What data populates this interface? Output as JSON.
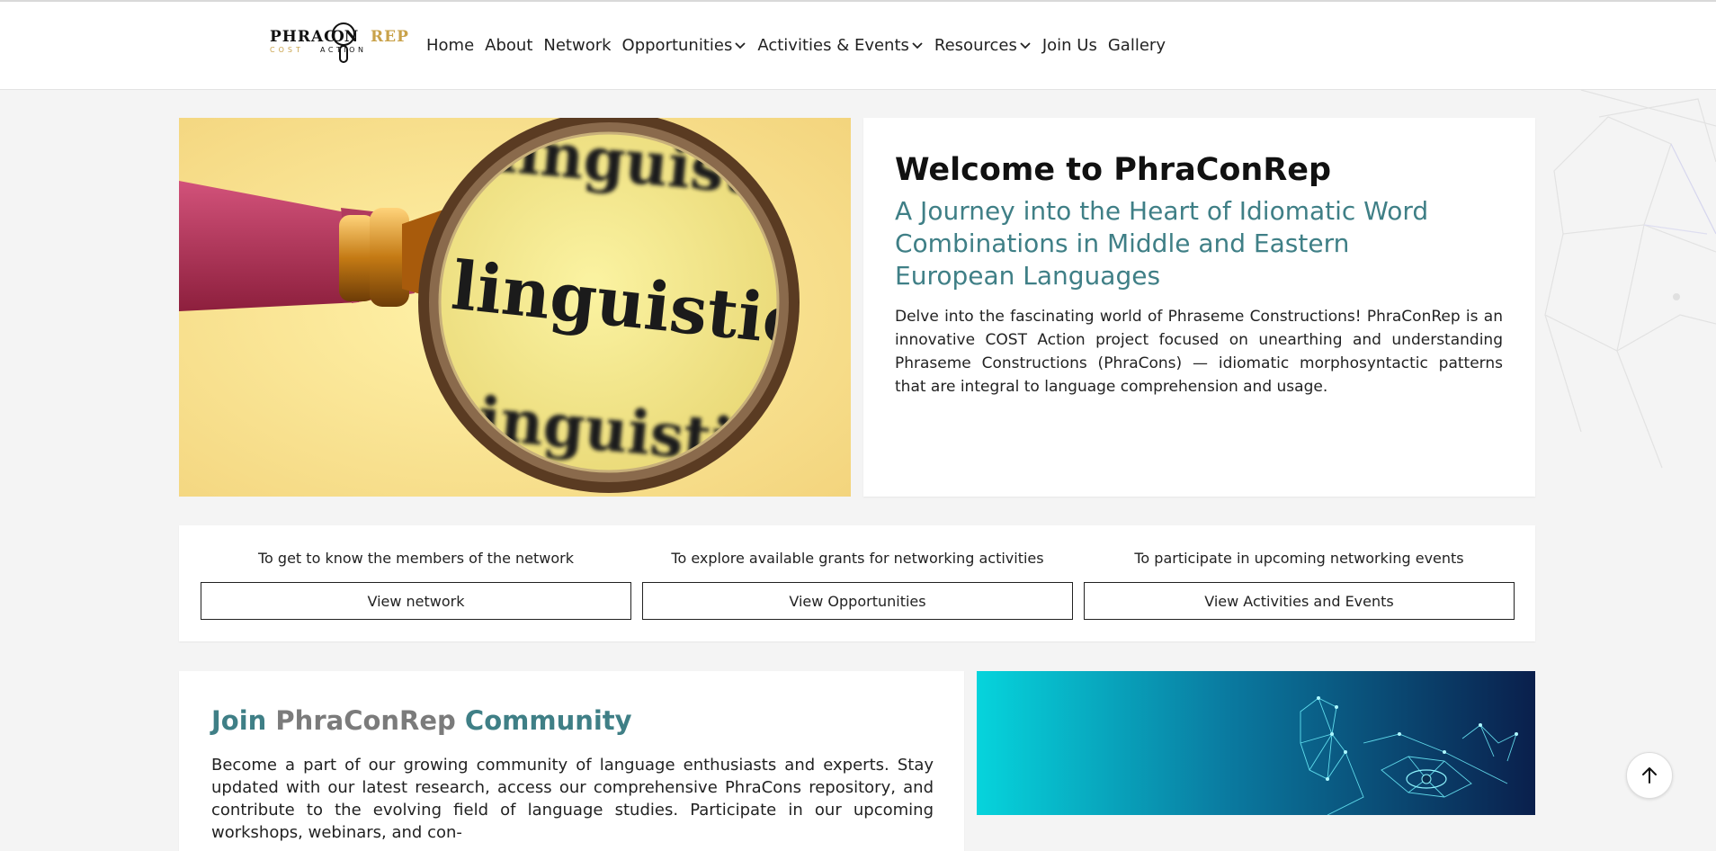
{
  "logo": {
    "line1_left": "PHRAC",
    "line1_mid": "ON",
    "line1_right": "REP",
    "line2_left": "COST",
    "line2_right": "ACTION"
  },
  "nav": {
    "items": [
      {
        "label": "Home",
        "dropdown": false
      },
      {
        "label": "About",
        "dropdown": false
      },
      {
        "label": "Network",
        "dropdown": false
      },
      {
        "label": "Opportunities",
        "dropdown": true
      },
      {
        "label": "Activities & Events",
        "dropdown": true
      },
      {
        "label": "Resources",
        "dropdown": true
      },
      {
        "label": "Join Us",
        "dropdown": false
      },
      {
        "label": "Gallery",
        "dropdown": false
      }
    ]
  },
  "hero": {
    "image_word": "linguistics",
    "image_word_top": "linguisti",
    "image_word_bottom": "inguisti"
  },
  "welcome": {
    "title": "Welcome to PhraConRep",
    "subtitle": "A Journey into the Heart of Idiomatic Word Combinations in Middle and Eastern European Languages",
    "body": "Delve into the fascinating world of Phraseme Constructions! PhraConRep is an innovative COST Action project focused on unearthing and understanding Phraseme Constructions (PhraCons) — idiomatic morphosyntactic patterns that are integral to language comprehension and usage."
  },
  "cta": [
    {
      "label": "To get to know the members of the network",
      "button": "View network"
    },
    {
      "label": "To explore available grants for networking activities",
      "button": "View Opportunities"
    },
    {
      "label": "To participate in upcoming networking events",
      "button": "View Activities and Events"
    }
  ],
  "join": {
    "title_start": "Join",
    "title_mid": "PhraConRep",
    "title_end": "Community",
    "body": "Become a part of our growing community of language enthusiasts and experts. Stay updated with our latest research, access our comprehensive PhraCons repository, and contribute to the evolving field of language studies. Participate in our upcoming workshops, webinars, and con-"
  },
  "colors": {
    "accent_teal": "#3f7f86",
    "logo_gold": "#c9a24a",
    "muted_gray": "#7b7b7b"
  },
  "icons": {
    "dropdown": "chevron-down-icon",
    "to_top": "arrow-up-icon",
    "logo_magnifier": "magnifier-icon"
  }
}
